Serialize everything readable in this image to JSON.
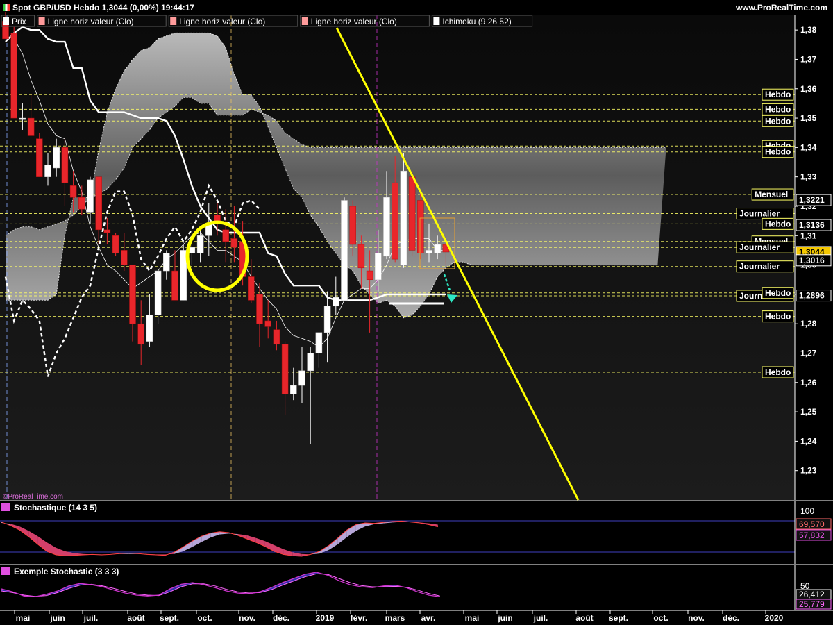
{
  "header": {
    "title": "Spot GBP/USD Hebdo 1,3044 (0,00%) 19:44:17",
    "site": "www.ProRealTime.com",
    "watermark": "©ProRealTime.com"
  },
  "legend": [
    {
      "label": "Prix",
      "color": "#ffffff"
    },
    {
      "label": "Ligne horiz valeur (Clo)",
      "color": "#ff9b9b"
    },
    {
      "label": "Ligne horiz valeur (Clo)",
      "color": "#ff9b9b"
    },
    {
      "label": "Ligne horiz valeur (Clo)",
      "color": "#ff9b9b"
    },
    {
      "label": "Ichimoku (9 26 52)",
      "color": "#ffffff"
    }
  ],
  "colors": {
    "background": "#000000",
    "bull": "#ffffff",
    "bear": "#e8262b",
    "trendline": "#ffff00",
    "level_dashed": "#ffff66",
    "cloud": "#bdbdbd",
    "stoch_fill": "#d33f6a",
    "stoch_bull_fill": "#b6a6d8",
    "exemple_line": "#cc33cc",
    "exemple_fill": "#3333aa",
    "arrow": "#2ee8c4",
    "grid_purple": "#4040c0"
  },
  "chart_data": [
    {
      "type": "candlestick",
      "title": "Spot GBP/USD Hebdo",
      "ylim": [
        1.22,
        1.385
      ],
      "y_ticks": [
        1.23,
        1.24,
        1.25,
        1.26,
        1.27,
        1.28,
        1.29,
        1.3,
        1.31,
        1.32,
        1.33,
        1.34,
        1.35,
        1.36,
        1.37,
        1.38
      ],
      "x_labels": [
        "mai",
        "juin",
        "juil.",
        "août",
        "sept.",
        "oct.",
        "nov.",
        "déc.",
        "2019",
        "févr.",
        "mars",
        "avr.",
        "mai",
        "juin",
        "juil.",
        "août",
        "sept.",
        "oct.",
        "nov.",
        "déc.",
        "2020"
      ],
      "candles": [
        {
          "o": 1.383,
          "h": 1.386,
          "l": 1.377,
          "c": 1.377
        },
        {
          "o": 1.379,
          "h": 1.381,
          "l": 1.35,
          "c": 1.35
        },
        {
          "o": 1.3495,
          "h": 1.355,
          "l": 1.346,
          "c": 1.35
        },
        {
          "o": 1.35,
          "h": 1.358,
          "l": 1.344,
          "c": 1.344
        },
        {
          "o": 1.343,
          "h": 1.345,
          "l": 1.33,
          "c": 1.33
        },
        {
          "o": 1.33,
          "h": 1.338,
          "l": 1.327,
          "c": 1.334
        },
        {
          "o": 1.333,
          "h": 1.343,
          "l": 1.33,
          "c": 1.34
        },
        {
          "o": 1.34,
          "h": 1.343,
          "l": 1.32,
          "c": 1.328
        },
        {
          "o": 1.327,
          "h": 1.332,
          "l": 1.318,
          "c": 1.323
        },
        {
          "o": 1.323,
          "h": 1.327,
          "l": 1.317,
          "c": 1.319
        },
        {
          "o": 1.318,
          "h": 1.33,
          "l": 1.314,
          "c": 1.329
        },
        {
          "o": 1.33,
          "h": 1.33,
          "l": 1.307,
          "c": 1.312
        },
        {
          "o": 1.312,
          "h": 1.316,
          "l": 1.307,
          "c": 1.311
        },
        {
          "o": 1.31,
          "h": 1.311,
          "l": 1.303,
          "c": 1.304
        },
        {
          "o": 1.305,
          "h": 1.311,
          "l": 1.298,
          "c": 1.3
        },
        {
          "o": 1.3,
          "h": 1.3,
          "l": 1.274,
          "c": 1.28
        },
        {
          "o": 1.28,
          "h": 1.288,
          "l": 1.266,
          "c": 1.273
        },
        {
          "o": 1.274,
          "h": 1.29,
          "l": 1.272,
          "c": 1.283
        },
        {
          "o": 1.283,
          "h": 1.298,
          "l": 1.28,
          "c": 1.298
        },
        {
          "o": 1.298,
          "h": 1.305,
          "l": 1.295,
          "c": 1.304
        },
        {
          "o": 1.298,
          "h": 1.305,
          "l": 1.289,
          "c": 1.288
        },
        {
          "o": 1.288,
          "h": 1.307,
          "l": 1.288,
          "c": 1.305
        },
        {
          "o": 1.304,
          "h": 1.31,
          "l": 1.3,
          "c": 1.306
        },
        {
          "o": 1.304,
          "h": 1.312,
          "l": 1.301,
          "c": 1.31
        },
        {
          "o": 1.31,
          "h": 1.321,
          "l": 1.303,
          "c": 1.314
        },
        {
          "o": 1.317,
          "h": 1.321,
          "l": 1.31,
          "c": 1.314
        },
        {
          "o": 1.312,
          "h": 1.319,
          "l": 1.301,
          "c": 1.308
        },
        {
          "o": 1.309,
          "h": 1.32,
          "l": 1.301,
          "c": 1.306
        },
        {
          "o": 1.308,
          "h": 1.315,
          "l": 1.293,
          "c": 1.296
        },
        {
          "o": 1.296,
          "h": 1.302,
          "l": 1.287,
          "c": 1.288
        },
        {
          "o": 1.29,
          "h": 1.294,
          "l": 1.272,
          "c": 1.28
        },
        {
          "o": 1.281,
          "h": 1.288,
          "l": 1.275,
          "c": 1.279
        },
        {
          "o": 1.278,
          "h": 1.281,
          "l": 1.271,
          "c": 1.273
        },
        {
          "o": 1.273,
          "h": 1.274,
          "l": 1.249,
          "c": 1.256
        },
        {
          "o": 1.256,
          "h": 1.265,
          "l": 1.254,
          "c": 1.259
        },
        {
          "o": 1.259,
          "h": 1.272,
          "l": 1.253,
          "c": 1.264
        },
        {
          "o": 1.264,
          "h": 1.272,
          "l": 1.239,
          "c": 1.27
        },
        {
          "o": 1.27,
          "h": 1.277,
          "l": 1.265,
          "c": 1.277
        },
        {
          "o": 1.277,
          "h": 1.291,
          "l": 1.267,
          "c": 1.286
        },
        {
          "o": 1.286,
          "h": 1.296,
          "l": 1.283,
          "c": 1.289
        },
        {
          "o": 1.288,
          "h": 1.323,
          "l": 1.288,
          "c": 1.322
        },
        {
          "o": 1.32,
          "h": 1.322,
          "l": 1.303,
          "c": 1.307
        },
        {
          "o": 1.307,
          "h": 1.31,
          "l": 1.292,
          "c": 1.299
        },
        {
          "o": 1.298,
          "h": 1.305,
          "l": 1.277,
          "c": 1.295
        },
        {
          "o": 1.295,
          "h": 1.312,
          "l": 1.291,
          "c": 1.304
        },
        {
          "o": 1.303,
          "h": 1.332,
          "l": 1.302,
          "c": 1.323
        },
        {
          "o": 1.328,
          "h": 1.337,
          "l": 1.301,
          "c": 1.302
        },
        {
          "o": 1.3,
          "h": 1.338,
          "l": 1.299,
          "c": 1.332
        },
        {
          "o": 1.33,
          "h": 1.332,
          "l": 1.303,
          "c": 1.305
        },
        {
          "o": 1.322,
          "h": 1.325,
          "l": 1.302,
          "c": 1.304
        },
        {
          "o": 1.304,
          "h": 1.314,
          "l": 1.301,
          "c": 1.305
        },
        {
          "o": 1.304,
          "h": 1.31,
          "l": 1.302,
          "c": 1.307
        },
        {
          "o": 1.307,
          "h": 1.31,
          "l": 1.3,
          "c": 1.3044
        }
      ],
      "ichimoku": {
        "kijun": [
          1.376,
          1.379,
          1.381,
          1.38,
          1.38,
          1.377,
          1.376,
          1.376,
          1.367,
          1.367,
          1.356,
          1.352,
          1.352,
          1.352,
          1.352,
          1.351,
          1.35,
          1.35,
          1.35,
          1.349,
          1.344,
          1.336,
          1.327,
          1.32,
          1.316,
          1.312,
          1.311,
          1.311,
          1.311,
          1.311,
          1.311,
          1.304,
          1.303,
          1.297,
          1.293,
          1.293,
          1.293,
          1.293,
          1.289,
          1.288,
          1.288,
          1.288,
          1.288,
          1.288,
          1.289,
          1.29,
          1.29,
          1.29,
          1.29,
          1.29,
          1.29,
          1.29,
          1.29
        ],
        "tenkan": [
          1.378,
          1.377,
          1.372,
          1.363,
          1.356,
          1.348,
          1.344,
          1.343,
          1.332,
          1.325,
          1.313,
          1.306,
          1.3,
          1.298,
          1.295,
          1.292,
          1.294,
          1.296,
          1.298,
          1.302,
          1.304,
          1.307,
          1.31,
          1.311,
          1.308,
          1.305,
          1.305,
          1.303,
          1.301,
          1.296,
          1.292,
          1.288,
          1.285,
          1.279,
          1.276,
          1.275,
          1.274,
          1.272,
          1.275,
          1.282,
          1.288,
          1.29,
          1.292,
          1.292,
          1.295,
          1.3,
          1.307,
          1.308,
          1.309,
          1.309,
          1.309,
          1.305,
          1.305
        ],
        "chikou": [
          1.296,
          1.281,
          1.288,
          1.285,
          1.281,
          1.262,
          1.27,
          1.275,
          1.282,
          1.289,
          1.293,
          1.306,
          1.318,
          1.325,
          1.325,
          1.317,
          1.302,
          1.298,
          1.303,
          1.309,
          1.313,
          1.308,
          1.312,
          1.318,
          1.327,
          1.322,
          1.315,
          1.313,
          1.321,
          1.322,
          1.319
        ]
      },
      "cloud": {
        "upper": [
          1.31,
          1.312,
          1.313,
          1.313,
          1.312,
          1.313,
          1.314,
          1.315,
          1.317,
          1.32,
          1.323,
          1.339,
          1.352,
          1.36,
          1.366,
          1.37,
          1.373,
          1.374,
          1.377,
          1.378,
          1.379,
          1.379,
          1.379,
          1.379,
          1.379,
          1.378,
          1.374,
          1.365,
          1.358,
          1.358,
          1.354,
          1.347,
          1.34,
          1.333,
          1.326,
          1.323,
          1.317,
          1.313,
          1.308,
          1.304,
          1.3,
          1.298,
          1.293,
          1.29,
          1.287,
          1.288,
          1.286,
          1.282,
          1.283,
          1.286,
          1.29,
          1.296,
          1.299,
          1.301,
          1.301,
          1.3,
          1.3,
          1.3,
          1.3,
          1.3,
          1.3,
          1.3,
          1.3,
          1.3,
          1.3,
          1.3,
          1.3,
          1.3,
          1.3,
          1.3,
          1.3,
          1.3,
          1.3,
          1.3,
          1.3,
          1.3,
          1.3,
          1.3
        ],
        "lower": [
          1.288,
          1.288,
          1.288,
          1.288,
          1.288,
          1.288,
          1.29,
          1.31,
          1.323,
          1.323,
          1.323,
          1.324,
          1.326,
          1.329,
          1.333,
          1.34,
          1.343,
          1.346,
          1.35,
          1.352,
          1.354,
          1.357,
          1.357,
          1.355,
          1.355,
          1.351,
          1.351,
          1.351,
          1.351,
          1.353,
          1.352,
          1.351,
          1.349,
          1.345,
          1.343,
          1.341,
          1.34,
          1.34,
          1.34,
          1.34,
          1.34,
          1.34,
          1.34,
          1.34,
          1.34,
          1.34,
          1.34,
          1.34,
          1.34,
          1.34,
          1.34,
          1.34,
          1.34,
          1.34,
          1.34,
          1.34,
          1.34,
          1.34,
          1.34,
          1.34,
          1.34,
          1.34,
          1.34,
          1.34,
          1.34,
          1.34,
          1.34,
          1.34,
          1.34,
          1.34,
          1.34,
          1.34,
          1.34,
          1.34,
          1.34,
          1.34,
          1.34,
          1.34,
          1.34
        ]
      },
      "levels": [
        {
          "label": "Hebdo",
          "value": 1.358
        },
        {
          "label": "Hebdo",
          "value": 1.353
        },
        {
          "label": "Hebdo",
          "value": 1.349
        },
        {
          "label": "Hebdo",
          "value": 1.3405
        },
        {
          "label": "Hebdo",
          "value": 1.3385
        },
        {
          "label": "Mensuel",
          "value": 1.324
        },
        {
          "label": "Journalier",
          "value": 1.3175
        },
        {
          "label": "Hebdo",
          "value": 1.314
        },
        {
          "label": "Mensuel",
          "value": 1.308
        },
        {
          "label": "Journalier",
          "value": 1.306
        },
        {
          "label": "Journalier",
          "value": 1.2995
        },
        {
          "label": "Journalier",
          "value": 1.2895
        },
        {
          "label": "Hebdo",
          "value": 1.2905
        },
        {
          "label": "Hebdo",
          "value": 1.2825
        },
        {
          "label": "Hebdo",
          "value": 1.2635
        }
      ],
      "price_tags": [
        {
          "text": "1,3221",
          "value": 1.3221,
          "highlight": false
        },
        {
          "text": "1,3136",
          "value": 1.3136,
          "highlight": false
        },
        {
          "text": "1,3044",
          "value": 1.3044,
          "highlight": true
        },
        {
          "text": "1,3016",
          "value": 1.3016,
          "highlight": false
        },
        {
          "text": "1,2896",
          "value": 1.2896,
          "highlight": false
        }
      ]
    },
    {
      "type": "area",
      "title": "Stochastique (14 3 5)",
      "y_ticks": [
        100
      ],
      "ylim": [
        0,
        100
      ],
      "k": [
        88,
        80,
        70,
        55,
        38,
        22,
        14,
        12,
        13,
        14,
        15,
        14,
        15,
        17,
        18,
        17,
        15,
        14,
        13,
        20,
        32,
        45,
        56,
        63,
        66,
        64,
        58,
        50,
        42,
        33,
        22,
        15,
        12,
        11,
        15,
        22,
        35,
        52,
        70,
        82,
        86,
        85,
        87,
        89,
        90,
        88,
        86,
        82,
        77
      ],
      "d": [
        86,
        84,
        78,
        68,
        56,
        42,
        30,
        22,
        18,
        16,
        15,
        15,
        15,
        16,
        16,
        16,
        16,
        15,
        15,
        16,
        22,
        32,
        43,
        53,
        60,
        62,
        61,
        58,
        52,
        45,
        36,
        27,
        20,
        16,
        15,
        17,
        25,
        38,
        54,
        68,
        78,
        83,
        85,
        87,
        88,
        88,
        87,
        85,
        82
      ],
      "tags": [
        {
          "text": "69,570",
          "color": "#ff6a6a"
        },
        {
          "text": "57,832",
          "color": "#e050e0"
        }
      ]
    },
    {
      "type": "line",
      "title": "Exemple Stochastic (3 3 3)",
      "y_ticks": [
        50
      ],
      "ylim": [
        0,
        100
      ],
      "k": [
        45,
        38,
        28,
        26,
        32,
        40,
        52,
        58,
        55,
        50,
        42,
        35,
        30,
        28,
        30,
        45,
        56,
        60,
        55,
        48,
        40,
        35,
        33,
        38,
        48,
        60,
        70,
        80,
        85,
        78,
        65,
        55,
        50,
        48,
        52,
        54,
        48,
        38,
        30,
        26
      ],
      "d": [
        40,
        36,
        30,
        27,
        29,
        36,
        46,
        54,
        56,
        52,
        46,
        39,
        33,
        30,
        29,
        38,
        50,
        57,
        57,
        52,
        44,
        38,
        35,
        36,
        43,
        54,
        64,
        74,
        81,
        80,
        70,
        60,
        53,
        50,
        50,
        51,
        49,
        42,
        34,
        28
      ],
      "tags": [
        {
          "text": "26,412",
          "color": "#ffffff"
        },
        {
          "text": "25,779",
          "color": "#ff66ff"
        }
      ]
    }
  ]
}
